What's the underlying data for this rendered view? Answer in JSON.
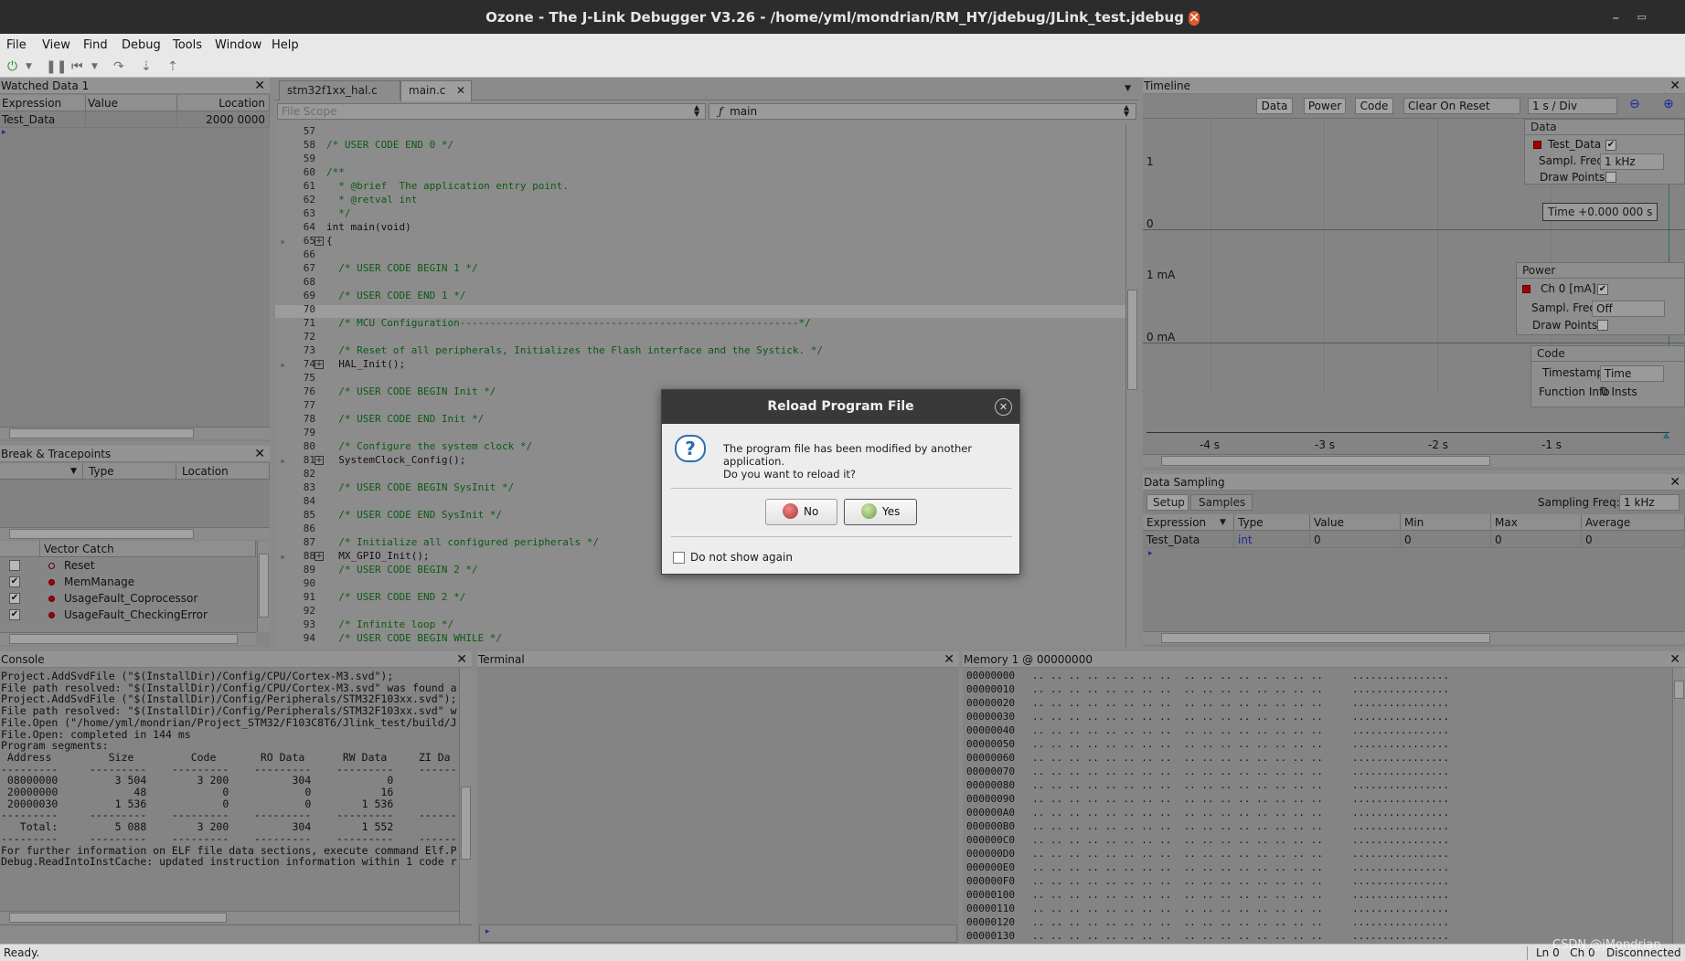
{
  "window": {
    "title": "Ozone - The J-Link Debugger V3.26 - /home/yml/mondrian/RM_HY/jdebug/JLink_test.jdebug"
  },
  "menu": [
    "File",
    "View",
    "Find",
    "Debug",
    "Tools",
    "Window",
    "Help"
  ],
  "watched": {
    "title": "Watched Data 1",
    "columns": [
      "Expression",
      "Value",
      "Location"
    ],
    "row": {
      "expression": "Test_Data",
      "value": "",
      "location": "2000 0000"
    }
  },
  "breakpoints": {
    "title": "Break & Tracepoints",
    "columns": [
      "Type",
      "Location"
    ],
    "vector_catch": {
      "header": "Vector Catch",
      "items": [
        {
          "label": "Reset",
          "checked": false
        },
        {
          "label": "MemManage",
          "checked": true
        },
        {
          "label": "UsageFault_Coprocessor",
          "checked": true
        },
        {
          "label": "UsageFault_CheckingError",
          "checked": true
        }
      ]
    }
  },
  "editor": {
    "tabs": [
      "stm32f1xx_hal.c",
      "main.c"
    ],
    "scope": "File Scope",
    "function": "main",
    "lines": [
      {
        "n": "57",
        "t": ""
      },
      {
        "n": "58",
        "t": "/* USER CODE END 0 */"
      },
      {
        "n": "59",
        "t": ""
      },
      {
        "n": "60",
        "t": "/**"
      },
      {
        "n": "61",
        "t": "  * @brief  The application entry point."
      },
      {
        "n": "62",
        "t": "  * @retval int"
      },
      {
        "n": "63",
        "t": "  */"
      },
      {
        "n": "64",
        "t": "int main(void)"
      },
      {
        "n": "65",
        "t": "{"
      },
      {
        "n": "66",
        "t": ""
      },
      {
        "n": "67",
        "t": "  /* USER CODE BEGIN 1 */"
      },
      {
        "n": "68",
        "t": ""
      },
      {
        "n": "69",
        "t": "  /* USER CODE END 1 */"
      },
      {
        "n": "70",
        "t": ""
      },
      {
        "n": "71",
        "t": "  /* MCU Configuration--------------------------------------------------------*/"
      },
      {
        "n": "72",
        "t": ""
      },
      {
        "n": "73",
        "t": "  /* Reset of all peripherals, Initializes the Flash interface and the Systick. */"
      },
      {
        "n": "74",
        "t": "  HAL_Init();"
      },
      {
        "n": "75",
        "t": ""
      },
      {
        "n": "76",
        "t": "  /* USER CODE BEGIN Init */"
      },
      {
        "n": "77",
        "t": ""
      },
      {
        "n": "78",
        "t": "  /* USER CODE END Init */"
      },
      {
        "n": "79",
        "t": ""
      },
      {
        "n": "80",
        "t": "  /* Configure the system clock */"
      },
      {
        "n": "81",
        "t": "  SystemClock_Config();"
      },
      {
        "n": "82",
        "t": ""
      },
      {
        "n": "83",
        "t": "  /* USER CODE BEGIN SysInit */"
      },
      {
        "n": "84",
        "t": ""
      },
      {
        "n": "85",
        "t": "  /* USER CODE END SysInit */"
      },
      {
        "n": "86",
        "t": ""
      },
      {
        "n": "87",
        "t": "  /* Initialize all configured peripherals */"
      },
      {
        "n": "88",
        "t": "  MX_GPIO_Init();"
      },
      {
        "n": "89",
        "t": "  /* USER CODE BEGIN 2 */"
      },
      {
        "n": "90",
        "t": ""
      },
      {
        "n": "91",
        "t": "  /* USER CODE END 2 */"
      },
      {
        "n": "92",
        "t": ""
      },
      {
        "n": "93",
        "t": "  /* Infinite loop */"
      },
      {
        "n": "94",
        "t": "  /* USER CODE BEGIN WHILE */"
      }
    ]
  },
  "timeline": {
    "title": "Timeline",
    "buttons": [
      "Data",
      "Power",
      "Code"
    ],
    "reset_mode": "Clear On Reset",
    "div": "1 s / Div",
    "y_labels": [
      "1",
      "0",
      "1 mA",
      "0 mA"
    ],
    "x_labels": [
      "-4 s",
      "-3 s",
      "-2 s",
      "-1 s"
    ],
    "time_readout": "Time   +0.000 000 s",
    "data_box": {
      "header": "Data",
      "signal": "Test_Data",
      "sampl_label": "Sampl. Freq",
      "sampl_value": "1 kHz",
      "draw_label": "Draw Points"
    },
    "power_box": {
      "header": "Power",
      "signal": "Ch 0 [mA]",
      "sampl_label": "Sampl. Freq",
      "sampl_value": "Off",
      "draw_label": "Draw Points"
    },
    "code_box": {
      "header": "Code",
      "ts_label": "Timestamps",
      "ts_value": "Time",
      "fi_label": "Function Info",
      "fi_value": "0 Insts"
    }
  },
  "sampling": {
    "title": "Data Sampling",
    "tabs": [
      "Setup",
      "Samples"
    ],
    "freq_label": "Sampling Freq:",
    "freq_value": "1 kHz",
    "columns": [
      "Expression",
      "Type",
      "Value",
      "Min",
      "Max",
      "Average"
    ],
    "row": [
      "Test_Data",
      "int",
      "0",
      "0",
      "0",
      "0"
    ]
  },
  "console": {
    "title": "Console",
    "lines": [
      "Project.AddSvdFile (\"$(InstallDir)/Config/CPU/Cortex-M3.svd\");",
      "File path resolved: \"$(InstallDir)/Config/CPU/Cortex-M3.svd\" was found a",
      "Project.AddSvdFile (\"$(InstallDir)/Config/Peripherals/STM32F103xx.svd\");",
      "File path resolved: \"$(InstallDir)/Config/Peripherals/STM32F103xx.svd\" w",
      "File.Open (\"/home/yml/mondrian/Project_STM32/F103C8T6/Jlink_test/build/J",
      "File.Open: completed in 144 ms",
      "Program segments:",
      " Address         Size         Code       RO Data      RW Data     ZI Da",
      "---------     ---------    ---------    ---------    ---------    ------",
      " 08000000         3 504        3 200          304            0",
      " 20000000            48            0            0           16",
      " 20000030         1 536            0            0        1 536",
      "---------     ---------    ---------    ---------    ---------    ------",
      "   Total:         5 088        3 200          304        1 552",
      "---------     ---------    ---------    ---------    ---------    ------",
      "For further information on ELF file data sections, execute command Elf.P",
      "Debug.ReadIntoInstCache: updated instruction information within 1 code r"
    ]
  },
  "terminal": {
    "title": "Terminal"
  },
  "memory": {
    "title": "Memory 1 @ 00000000",
    "rows": [
      "00000000",
      "00000010",
      "00000020",
      "00000030",
      "00000040",
      "00000050",
      "00000060",
      "00000070",
      "00000080",
      "00000090",
      "000000A0",
      "000000B0",
      "000000C0",
      "000000D0",
      "000000E0",
      "000000F0",
      "00000100",
      "00000110",
      "00000120",
      "00000130"
    ],
    "hex": ".. .. .. .. .. .. .. ..  .. .. .. .. .. .. .. ..",
    "ascii": "................"
  },
  "dialog": {
    "title": "Reload Program File",
    "message_line1": "The program file has been modified by another application.",
    "message_line2": "Do you want to reload it?",
    "no_label": "No",
    "yes_label": "Yes",
    "checkbox_label": "Do not show again"
  },
  "status": {
    "text": "Ready.",
    "position": "Ln 0   Ch 0",
    "connection": "Disconnected",
    "watermark": "CSDN @jMondrian"
  },
  "colors": {
    "accent_red": "#a40000",
    "title_bg": "#2c2c2c",
    "close_orange": "#e05a2b"
  }
}
